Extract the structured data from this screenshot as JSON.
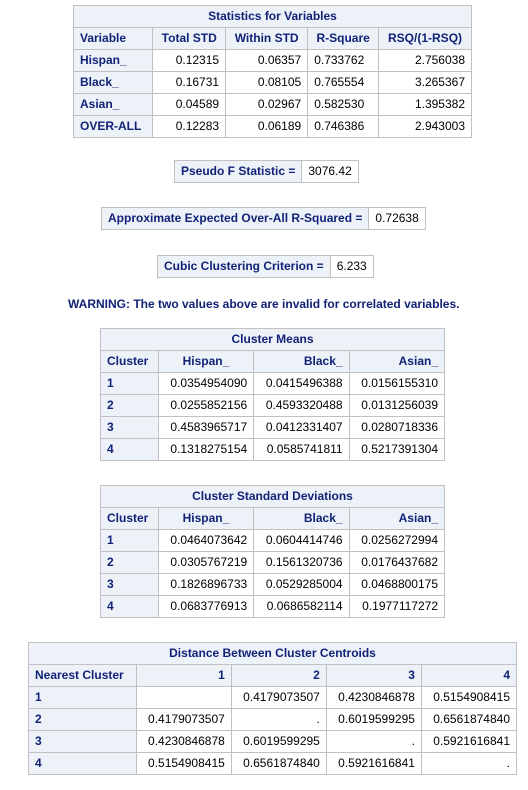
{
  "stats_table": {
    "caption": "Statistics for Variables",
    "headers": [
      "Variable",
      "Total STD",
      "Within STD",
      "R-Square",
      "RSQ/(1-RSQ)"
    ],
    "rows": [
      {
        "variable": "Hispan_",
        "total_std": "0.12315",
        "within_std": "0.06357",
        "r_square": "0.733762",
        "rsq_ratio": "2.756038"
      },
      {
        "variable": "Black_",
        "total_std": "0.16731",
        "within_std": "0.08105",
        "r_square": "0.765554",
        "rsq_ratio": "3.265367"
      },
      {
        "variable": "Asian_",
        "total_std": "0.04589",
        "within_std": "0.02967",
        "r_square": "0.582530",
        "rsq_ratio": "1.395382"
      },
      {
        "variable": "OVER-ALL",
        "total_std": "0.12283",
        "within_std": "0.06189",
        "r_square": "0.746386",
        "rsq_ratio": "2.943003"
      }
    ]
  },
  "pseudo_f": {
    "label": "Pseudo F Statistic =",
    "value": "3076.42"
  },
  "expected_r2": {
    "label": "Approximate Expected Over-All R-Squared =",
    "value": "0.72638"
  },
  "ccc": {
    "label": "Cubic Clustering Criterion =",
    "value": "6.233"
  },
  "warning": "WARNING: The two values above are invalid for correlated variables.",
  "cluster_means": {
    "caption": "Cluster Means",
    "headers": [
      "Cluster",
      "Hispan_",
      "Black_",
      "Asian_"
    ],
    "rows": [
      {
        "cluster": "1",
        "hispan": "0.0354954090",
        "black": "0.0415496388",
        "asian": "0.0156155310"
      },
      {
        "cluster": "2",
        "hispan": "0.0255852156",
        "black": "0.4593320488",
        "asian": "0.0131256039"
      },
      {
        "cluster": "3",
        "hispan": "0.4583965717",
        "black": "0.0412331407",
        "asian": "0.0280718336"
      },
      {
        "cluster": "4",
        "hispan": "0.1318275154",
        "black": "0.0585741811",
        "asian": "0.5217391304"
      }
    ]
  },
  "cluster_std": {
    "caption": "Cluster Standard Deviations",
    "headers": [
      "Cluster",
      "Hispan_",
      "Black_",
      "Asian_"
    ],
    "rows": [
      {
        "cluster": "1",
        "hispan": "0.0464073642",
        "black": "0.0604414746",
        "asian": "0.0256272994"
      },
      {
        "cluster": "2",
        "hispan": "0.0305767219",
        "black": "0.1561320736",
        "asian": "0.0176437682"
      },
      {
        "cluster": "3",
        "hispan": "0.1826896733",
        "black": "0.0529285004",
        "asian": "0.0468800175"
      },
      {
        "cluster": "4",
        "hispan": "0.0683776913",
        "black": "0.0686582114",
        "asian": "0.1977117272"
      }
    ]
  },
  "distance": {
    "caption": "Distance Between Cluster Centroids",
    "headers": [
      "Nearest Cluster",
      "1",
      "2",
      "3",
      "4"
    ],
    "rows": [
      {
        "cluster": "1",
        "c1": "",
        "c2": "0.4179073507",
        "c3": "0.4230846878",
        "c4": "0.5154908415"
      },
      {
        "cluster": "2",
        "c1": "0.4179073507",
        "c2": ".",
        "c3": "0.6019599295",
        "c4": "0.6561874840"
      },
      {
        "cluster": "3",
        "c1": "0.4230846878",
        "c2": "0.6019599295",
        "c3": ".",
        "c4": "0.5921616841"
      },
      {
        "cluster": "4",
        "c1": "0.5154908415",
        "c2": "0.6561874840",
        "c3": "0.5921616841",
        "c4": "."
      }
    ]
  }
}
